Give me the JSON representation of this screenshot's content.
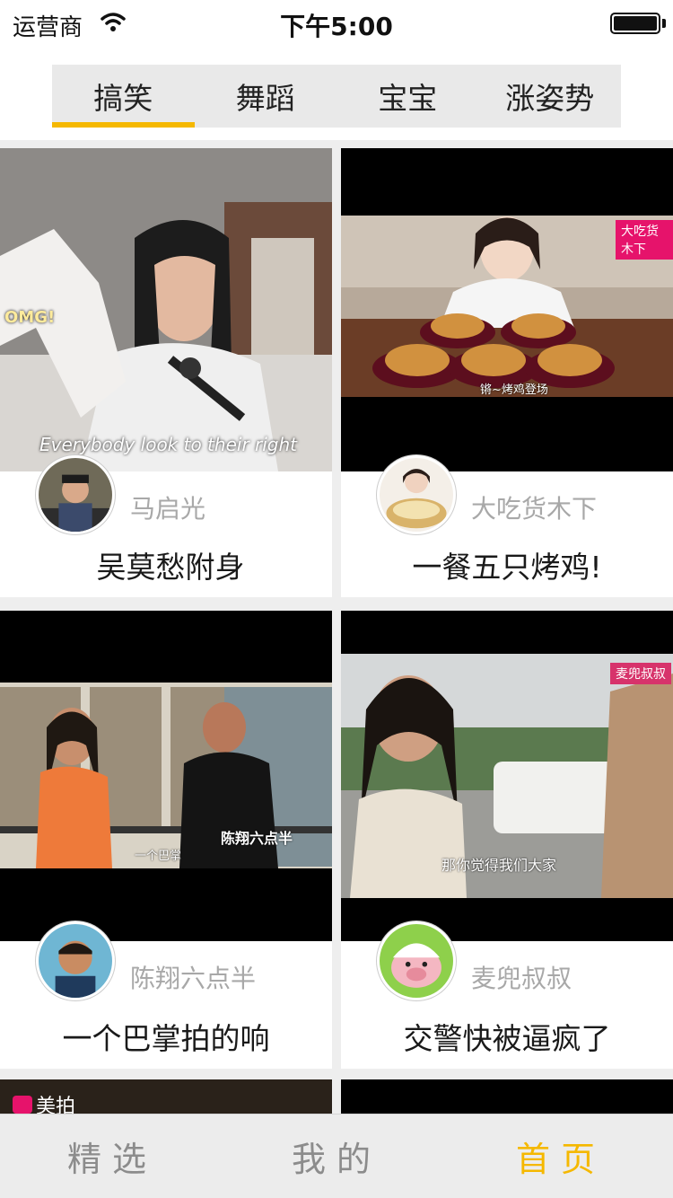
{
  "status_bar": {
    "carrier": "运营商",
    "time": "下午5:00"
  },
  "tabs": [
    {
      "label": "搞笑",
      "active": true
    },
    {
      "label": "舞蹈",
      "active": false
    },
    {
      "label": "宝宝",
      "active": false
    },
    {
      "label": "涨姿势",
      "active": false
    }
  ],
  "cards": [
    {
      "author": "马启光",
      "title": "吴莫愁附身",
      "caption": "Everybody look to their right",
      "overlay": "OMG!"
    },
    {
      "author": "大吃货木下",
      "title": "一餐五只烤鸡!",
      "tag": "大吃货木下",
      "subtitle": "锵~烤鸡登场"
    },
    {
      "author": "陈翔六点半",
      "title": "一个巴掌拍的响",
      "subtitle": "一个巴掌",
      "watermark": "陈翔六点半"
    },
    {
      "author": "麦兜叔叔",
      "title": "交警快被逼疯了",
      "tag": "麦兜叔叔",
      "subtitle": "那你觉得我们大家"
    }
  ],
  "partial_card": {
    "brand": "美拍"
  },
  "bottom_nav": [
    {
      "label": "精选",
      "active": false
    },
    {
      "label": "我的",
      "active": false
    },
    {
      "label": "首页",
      "active": true
    }
  ],
  "colors": {
    "accent": "#f5b800",
    "tag": "#e6136b"
  }
}
